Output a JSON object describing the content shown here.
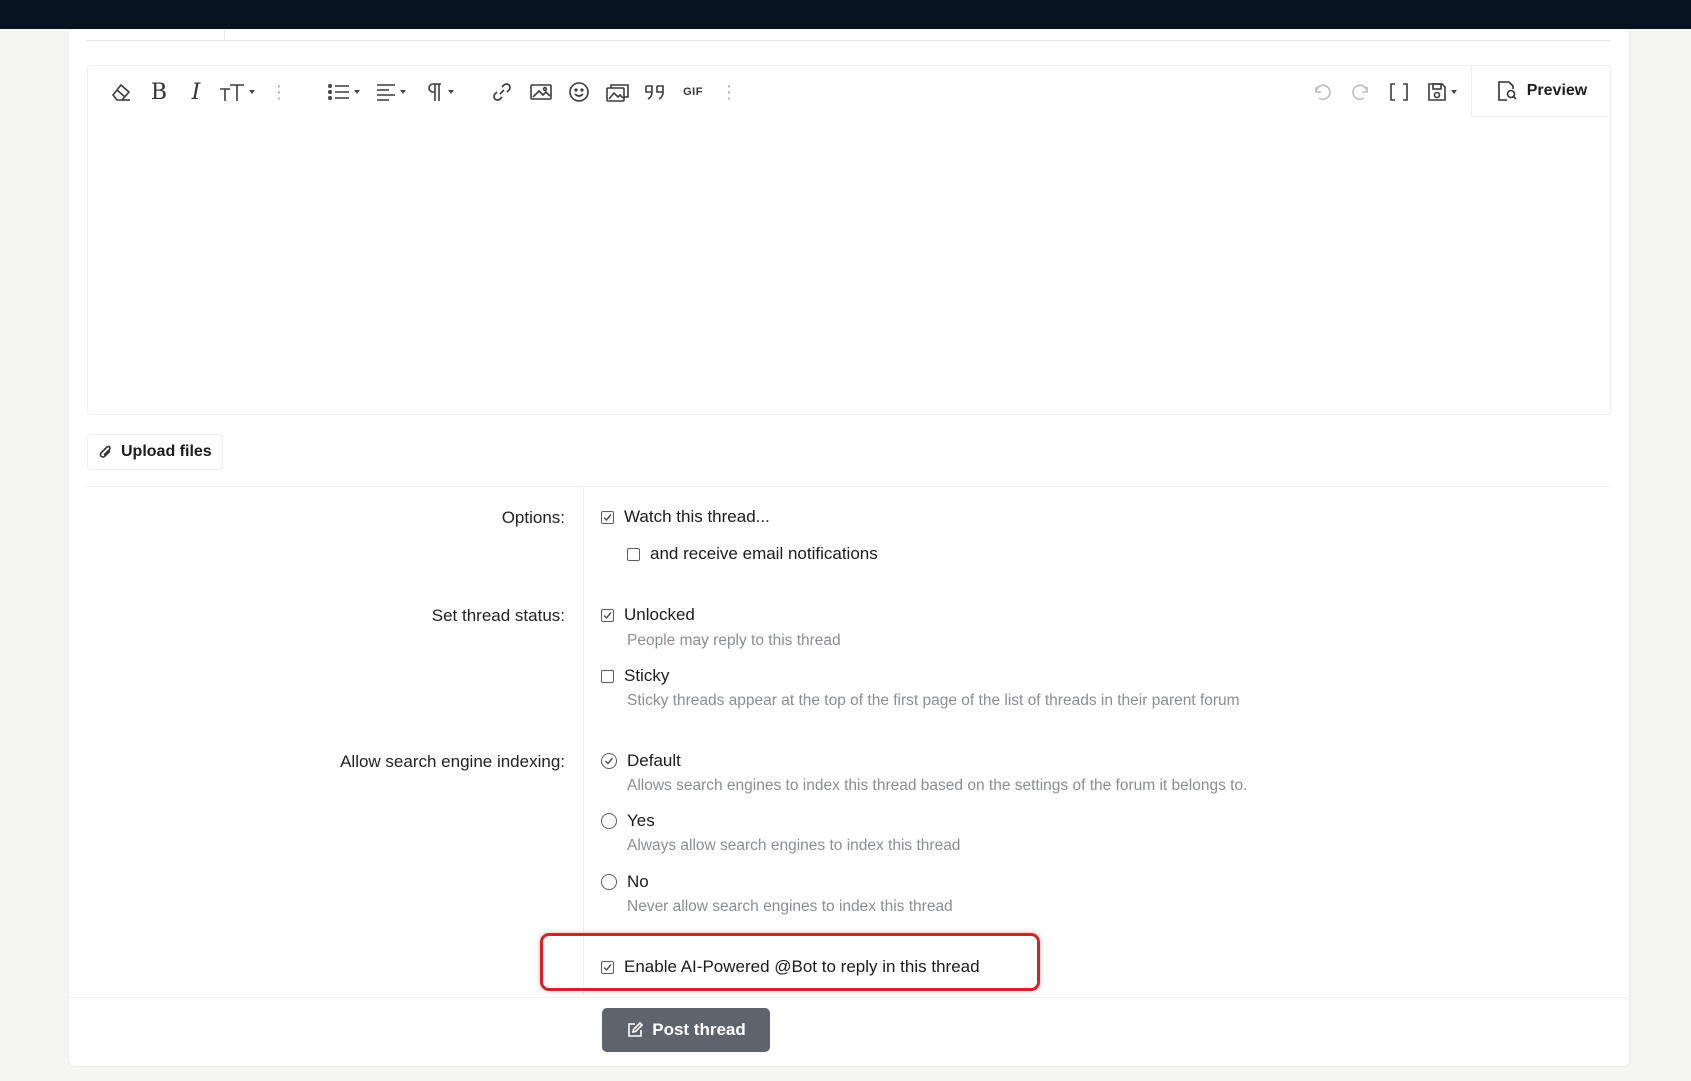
{
  "editor": {
    "toolbar": {
      "preview_label": "Preview",
      "gif_label": "GIF"
    }
  },
  "upload": {
    "label": "Upload files"
  },
  "form": {
    "options": {
      "label": "Options:",
      "watch_thread": {
        "label": "Watch this thread...",
        "checked": true
      },
      "email_notifications": {
        "label": "and receive email notifications",
        "checked": false
      }
    },
    "thread_status": {
      "label": "Set thread status:",
      "unlocked": {
        "label": "Unlocked",
        "hint": "People may reply to this thread",
        "checked": true
      },
      "sticky": {
        "label": "Sticky",
        "hint": "Sticky threads appear at the top of the first page of the list of threads in their parent forum",
        "checked": false
      }
    },
    "search_indexing": {
      "label": "Allow search engine indexing:",
      "selected": "Default",
      "options": [
        {
          "label": "Default",
          "hint": "Allows search engines to index this thread based on the settings of the forum it belongs to."
        },
        {
          "label": "Yes",
          "hint": "Always allow search engines to index this thread"
        },
        {
          "label": "No",
          "hint": "Never allow search engines to index this thread"
        }
      ]
    },
    "ai_bot": {
      "label": "Enable AI-Powered @Bot to reply in this thread",
      "checked": true
    }
  },
  "footer": {
    "post_button_label": "Post thread"
  },
  "colors": {
    "topbar": "#06121f",
    "highlight": "#d3232a",
    "post_button": "#5e646b"
  }
}
